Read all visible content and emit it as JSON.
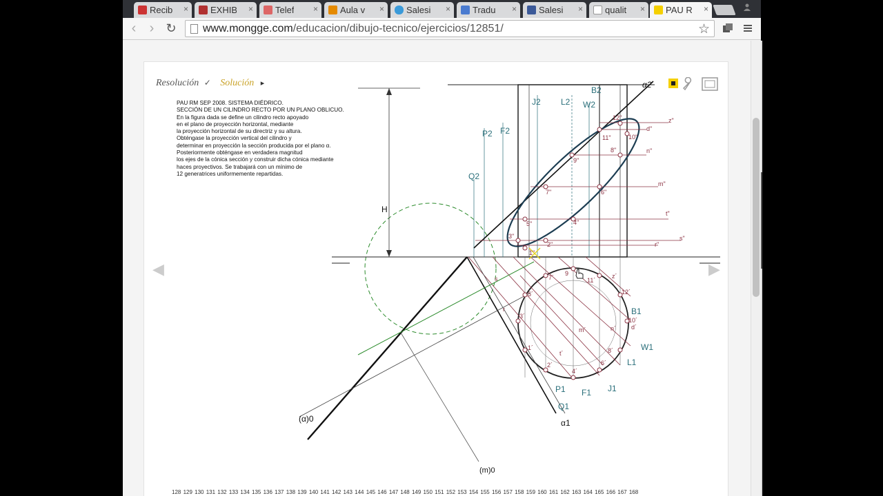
{
  "tabs": [
    {
      "label": "Recib",
      "favicon": "gmail-icon",
      "color": "#c33"
    },
    {
      "label": "EXHIB",
      "favicon": "site-icon",
      "color": "#b03030"
    },
    {
      "label": "Telef",
      "favicon": "music-icon",
      "color": "#d66"
    },
    {
      "label": "Aula v",
      "favicon": "moodle-icon",
      "color": "#e58a00"
    },
    {
      "label": "Salesi",
      "favicon": "twitter-icon",
      "color": "#3a9ad9"
    },
    {
      "label": "Tradu",
      "favicon": "translate-icon",
      "color": "#4a7bd0"
    },
    {
      "label": "Salesi",
      "favicon": "facebook-icon",
      "color": "#3b5998"
    },
    {
      "label": "qualit",
      "favicon": "page-icon",
      "color": "#999"
    },
    {
      "label": "PAU R",
      "favicon": "mongge-icon",
      "color": "#f5d000"
    }
  ],
  "tab_close_glyph": "×",
  "address": {
    "host": "www.mongge.com",
    "path": "/educacion/dibujo-tecnico/ejercicios/12851/"
  },
  "nav": {
    "back": "‹",
    "forward": "›",
    "reload": "↻",
    "star": "☆"
  },
  "panel": {
    "menu": {
      "resolucion": "Resolución",
      "check": "✓",
      "solucion": "Solución",
      "play": "▸"
    },
    "statement": [
      "PAU RM SEP 2008. SISTEMA DIÉDRICO.",
      "SECCIÓN DE UN CILINDRO RECTO POR UN PLANO OBLICUO.",
      "En la figura dada se define un cilindro recto apoyado",
      "en el plano de proyección horizontal, mediante",
      "la proyección horizontal de su directriz y su altura.",
      "Obténgase la proyección vertical del cilindro y",
      "determinar en proyección la sección producida por el plano α.",
      "Posteriormente obténgase en verdadera magnitud",
      "los ejes de la cónica sección y construir dicha cónica mediante",
      "haces proyectivos. Se trabajará con un mínimo de",
      "12 generatrices uniformemente repartidas."
    ],
    "ruler": "128 129 130 131 132 133 134 135 136 137 138 139 140 141 142 143 144 145 146 147 148 149 150 151 152 153 154 155 156 157 158 159 160 161 162 163 164 165 166 167 168",
    "nav_prev": "◀",
    "nav_next": "▶"
  },
  "labels": {
    "alpha2": "α2",
    "beta": "B2",
    "j2": "J2",
    "l2": "L2",
    "w2": "W2",
    "p2": "P2",
    "f2": "F2",
    "q2": "Q2",
    "h": "H",
    "z2": "z\"",
    "d2": "d\"",
    "n2": "n\"",
    "m2": "m\"",
    "t2": "t\"",
    "s2": "s\"",
    "r2": "r\"",
    "p12": "12\"",
    "p11": "11\"",
    "p10": "10\"",
    "p9": "9\"",
    "p8": "8\"",
    "p7": "7\"",
    "p6": "6\"",
    "p5": "5\"",
    "p4": "4\"",
    "p3": "3\"",
    "p2b": "2\"",
    "p1": "1\"",
    "alpha0": "(α)0",
    "alpha1": "α1",
    "m0": "(m)0",
    "q1": "Q1",
    "p1b": "P1",
    "f1": "F1",
    "j1": "J1",
    "l1": "L1",
    "w1": "W1",
    "b1": "B1",
    "h9": "9",
    "h11": "11´",
    "h12": "12´",
    "h10": "10´",
    "hd": "d´",
    "hz": "z´",
    "hn": "n´",
    "hm": "m´",
    "h8": "8´",
    "h6": "6´",
    "h4": "4´",
    "h2": "2´",
    "h1": "1´",
    "h3": "3´",
    "h5": "5´",
    "h7": "7´",
    "ht": "t´",
    "hr": "r",
    "hs": "s"
  }
}
